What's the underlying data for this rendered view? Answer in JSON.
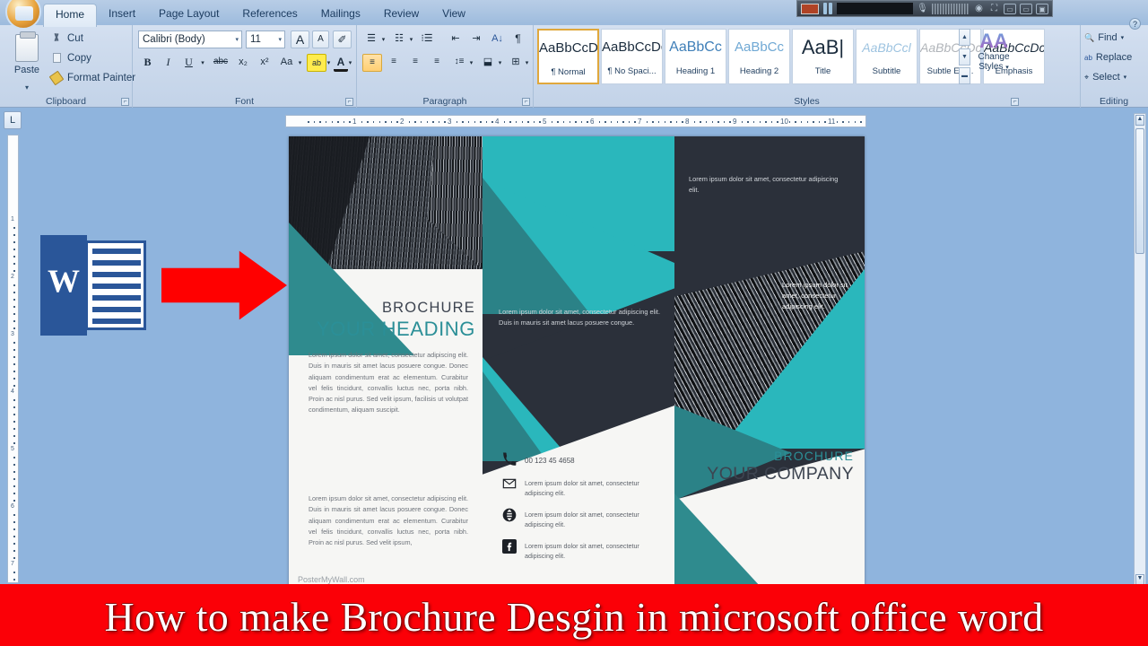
{
  "app": {
    "name": "Microsoft Office Word",
    "office_button": "Office Button"
  },
  "ribbon": {
    "tabs": [
      {
        "label": "Home",
        "active": true
      },
      {
        "label": "Insert",
        "active": false
      },
      {
        "label": "Page Layout",
        "active": false
      },
      {
        "label": "References",
        "active": false
      },
      {
        "label": "Mailings",
        "active": false
      },
      {
        "label": "Review",
        "active": false
      },
      {
        "label": "View",
        "active": false
      }
    ],
    "help_icon": "?",
    "groups": {
      "clipboard": {
        "label": "Clipboard",
        "paste": "Paste",
        "cut": "Cut",
        "copy": "Copy",
        "format_painter": "Format Painter"
      },
      "font": {
        "label": "Font",
        "font_name": "Calibri (Body)",
        "font_size": "11",
        "grow_font": "A",
        "shrink_font": "A",
        "clear_formatting": "clear-formatting-icon",
        "bold": "B",
        "italic": "I",
        "underline": "U",
        "strikethrough": "abc",
        "subscript": "x₂",
        "superscript": "x²",
        "change_case": "Aa",
        "highlight": "ab",
        "font_color": "A"
      },
      "paragraph": {
        "label": "Paragraph",
        "bullets": "bullets-icon",
        "numbering": "numbering-icon",
        "multilevel": "multilevel-list-icon",
        "decrease_indent": "decrease-indent-icon",
        "increase_indent": "increase-indent-icon",
        "sort": "sort-icon",
        "show_marks": "¶",
        "align_left": "align-left-icon",
        "align_center": "align-center-icon",
        "align_right": "align-right-icon",
        "justify": "justify-icon",
        "line_spacing": "line-spacing-icon",
        "shading": "shading-icon",
        "borders": "borders-icon"
      },
      "styles": {
        "label": "Styles",
        "items": [
          {
            "sample": "AaBbCcDc",
            "name": "¶ Normal",
            "selected": true
          },
          {
            "sample": "AaBbCcDc",
            "name": "¶ No Spaci...",
            "selected": false
          },
          {
            "sample": "AaBbCс",
            "name": "Heading 1",
            "selected": false
          },
          {
            "sample": "AaBbCc",
            "name": "Heading 2",
            "selected": false
          },
          {
            "sample": "AaB|",
            "name": "Title",
            "selected": false
          },
          {
            "sample": "AaBbCcl",
            "name": "Subtitle",
            "selected": false
          },
          {
            "sample": "AaBbCcDс",
            "name": "Subtle Em...",
            "selected": false
          },
          {
            "sample": "AaBbCcDс",
            "name": "Emphasis",
            "selected": false
          }
        ],
        "scroll_up": "▲",
        "scroll_down": "▼",
        "gallery_more": "▬",
        "change_styles": "Change Styles"
      },
      "editing": {
        "label": "Editing",
        "find": "Find",
        "replace": "Replace",
        "select": "Select"
      }
    }
  },
  "rulers": {
    "corner_tab_stop": "L",
    "horizontal_ticks": [
      "1",
      "2",
      "3",
      "4",
      "5",
      "6",
      "7",
      "8",
      "9",
      "10",
      "11"
    ],
    "vertical_ticks": [
      "1",
      "2",
      "3",
      "4",
      "5",
      "6",
      "7"
    ]
  },
  "scrollbar": {
    "up_arrow": "▲",
    "down_arrow": "▼"
  },
  "document": {
    "brochure": {
      "left_panel": {
        "photo": "city-skyscrapers-photo",
        "title_small": "BROCHURE",
        "title_large": "YOUR HEADING",
        "paragraph_1": "Lorem ipsum dolor sit amet, consectetur adipiscing elit. Duis in mauris sit amet lacus posuere congue. Donec aliquam condimentum erat ac elementum. Curabitur vel felis tincidunt, convallis luctus nec, porta nibh. Proin ac nisl purus. Sed velit ipsum, facilisis ut volutpat condimentum, aliquam suscipit.",
        "paragraph_2": "Lorem ipsum dolor sit amet, consectetur adipiscing elit. Duis in mauris sit amet lacus posuere congue. Donec aliquam condimentum erat ac elementum. Curabitur vel felis tincidunt, convallis luctus nec, porta nibh. Proin ac nisl purus. Sed velit ipsum,",
        "watermark": "PosterMyWall.com"
      },
      "middle_panel": {
        "paragraph": "Lorem ipsum dolor sit amet, consectetur adipiscing elit. Duis in mauris sit amet lacus posuere congue.",
        "contacts": [
          {
            "icon": "phone-icon",
            "text": "00 123 45 4658"
          },
          {
            "icon": "mail-icon",
            "text": "Lorem ipsum dolor sit amet, consectetur adipiscing elit."
          },
          {
            "icon": "globe-icon",
            "text": "Lorem ipsum dolor sit amet, consectetur adipiscing elit."
          },
          {
            "icon": "facebook-icon",
            "text": "Lorem ipsum dolor sit amet, consectetur adipiscing elit."
          }
        ]
      },
      "right_panel": {
        "paragraph_top": "Lorem ipsum dolor sit amet, consectetur adipiscing elit.",
        "paragraph_teal": "Lorem ipsum dolor sit amet, consectetur adipiscing elit.",
        "photo": "glass-building-photo",
        "title_small": "BROCHURE",
        "title_large": "YOUR COMPANY"
      },
      "colors": {
        "teal": "#2ab7bc",
        "teal_dark": "#2b8287",
        "navy": "#2b303a",
        "paper": "#f6f6f4",
        "heading_teal": "#2b8f97"
      }
    }
  },
  "overlays": {
    "word_logo": {
      "letter": "W",
      "color": "#2a5699"
    },
    "arrow": {
      "name": "red-arrow-icon",
      "color": "#ff0000"
    },
    "video_player": {
      "record": "record-indicator",
      "pause": "pause-button",
      "timecode": "timecode-display",
      "mic": "microphone-icon",
      "equalizer": "audio-level-meter",
      "settings": "settings-icon",
      "fullscreen": "fullscreen-icon",
      "window": "window-icon",
      "screen": "screen-icon",
      "monitor": "monitor-icon"
    },
    "banner": {
      "text": "How to make Brochure Desgin in microsoft office word",
      "background": "#fb0007",
      "text_color": "#ffffff"
    }
  }
}
